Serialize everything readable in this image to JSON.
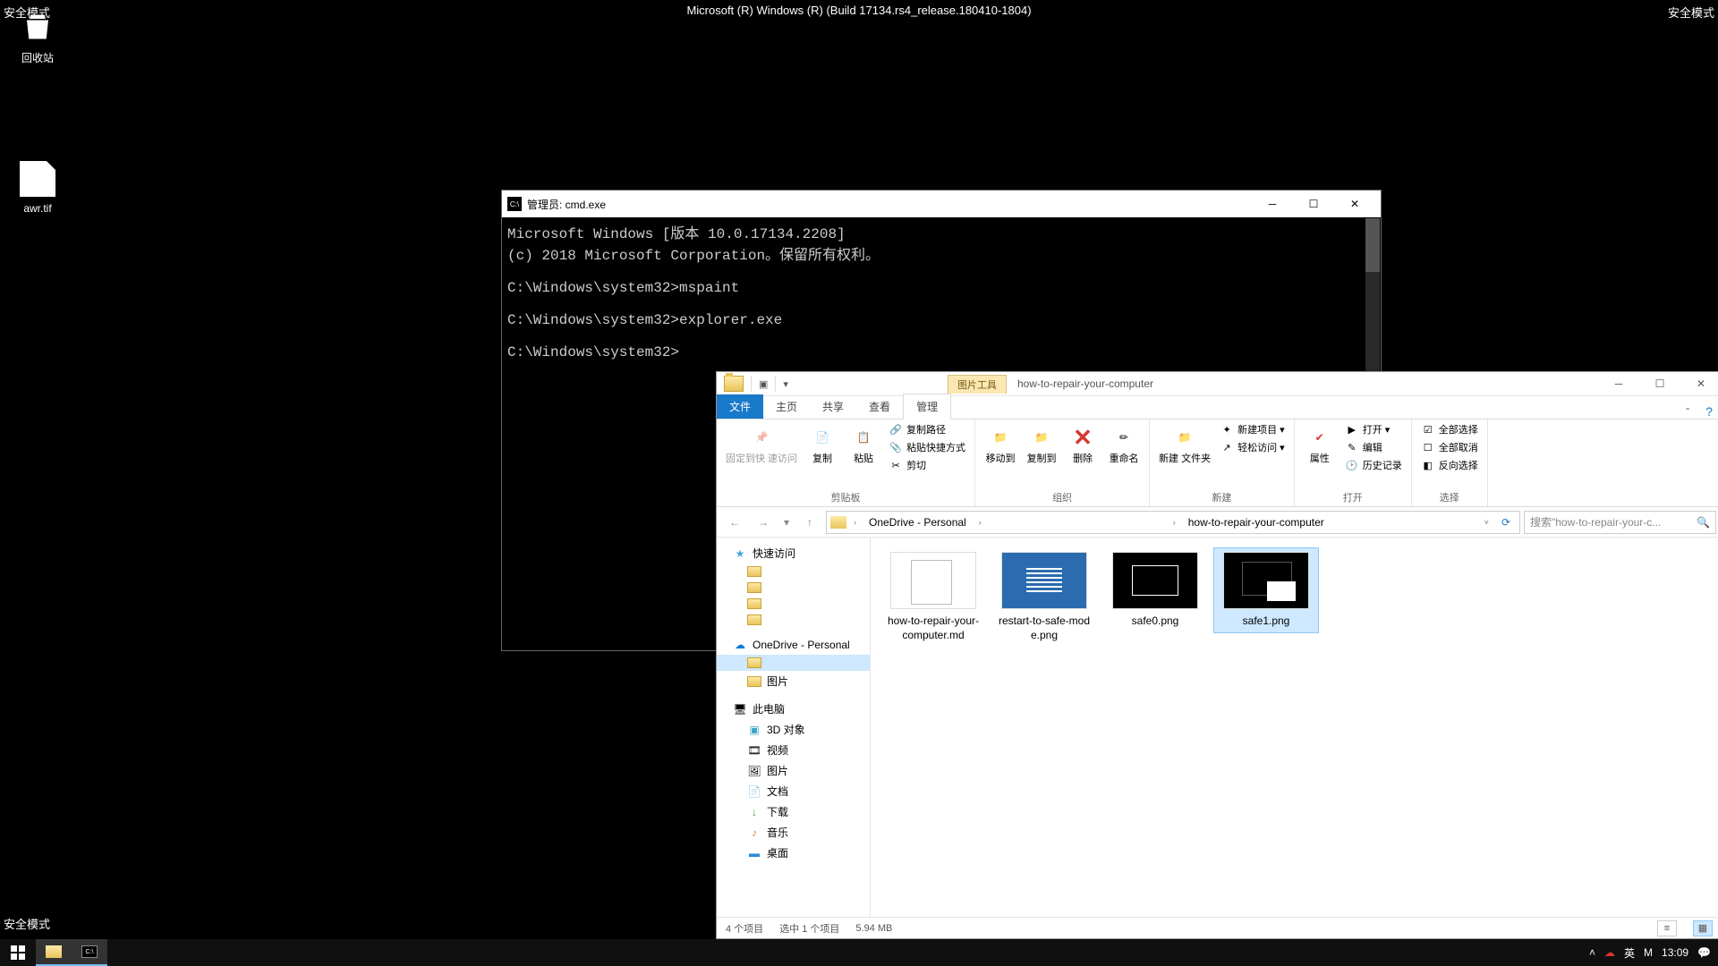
{
  "safemode_label": "安全模式",
  "build_text": "Microsoft (R) Windows (R) (Build 17134.rs4_release.180410-1804)",
  "desktop": {
    "recycle": "回收站",
    "file1": "awr.tif"
  },
  "cmd": {
    "title": "管理员: cmd.exe",
    "body": "Microsoft Windows [版本 10.0.17134.2208]\n(c) 2018 Microsoft Corporation。保留所有权利。\n\nC:\\Windows\\system32>mspaint\n\nC:\\Windows\\system32>explorer.exe\n\nC:\\Windows\\system32>"
  },
  "explorer": {
    "context_tab": "图片工具",
    "window_title": "how-to-repair-your-computer",
    "tabs": {
      "file": "文件",
      "home": "主页",
      "share": "共享",
      "view": "查看",
      "manage": "管理"
    },
    "ribbon": {
      "pin": "固定到快\n速访问",
      "copy": "复制",
      "paste": "粘贴",
      "copypath": "复制路径",
      "pasteshort": "粘贴快捷方式",
      "cut": "剪切",
      "g_clip": "剪贴板",
      "moveto": "移动到",
      "copyto": "复制到",
      "delete": "删除",
      "rename": "重命名",
      "g_org": "组织",
      "newfolder": "新建\n文件夹",
      "newitem": "新建项目 ▾",
      "easyaccess": "轻松访问 ▾",
      "g_new": "新建",
      "props": "属性",
      "open": "打开 ▾",
      "edit": "编辑",
      "history": "历史记录",
      "g_open": "打开",
      "selall": "全部选择",
      "selnone": "全部取消",
      "selinv": "反向选择",
      "g_sel": "选择"
    },
    "breadcrumb": {
      "seg1": "OneDrive - Personal",
      "seg2": "how-to-repair-your-computer"
    },
    "search_placeholder": "搜索\"how-to-repair-your-c...",
    "nav": {
      "quick": "快速访问",
      "onedrive": "OneDrive - Personal",
      "pictures": "图片",
      "thispc": "此电脑",
      "obj3d": "3D 对象",
      "videos": "视频",
      "pics": "图片",
      "docs": "文档",
      "downloads": "下载",
      "music": "音乐",
      "desktop": "桌面"
    },
    "files": {
      "f1": "how-to-repair-your-computer.md",
      "f2": "restart-to-safe-mode.png",
      "f3": "safe0.png",
      "f4": "safe1.png"
    },
    "status": {
      "count": "4 个项目",
      "sel": "选中 1 个项目",
      "size": "5.94 MB"
    }
  },
  "taskbar": {
    "ime1": "英",
    "ime2": "M",
    "clock": "13:09"
  }
}
